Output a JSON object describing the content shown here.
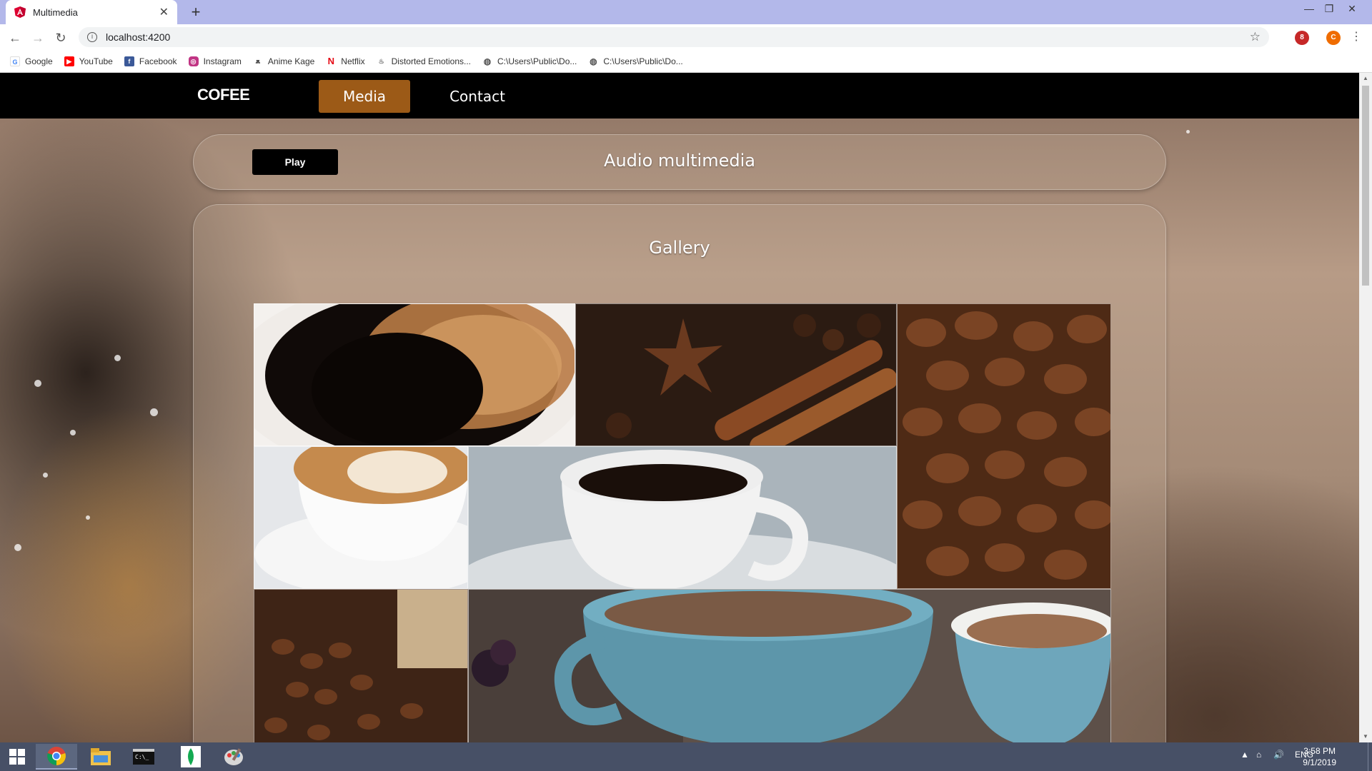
{
  "browser": {
    "tab_title": "Multimedia",
    "new_tab_label": "+",
    "url": "localhost:4200",
    "bookmarks": [
      {
        "label": "Google",
        "icon": "google-icon",
        "color": "#4285f4"
      },
      {
        "label": "YouTube",
        "icon": "youtube-icon",
        "color": "#ff0000"
      },
      {
        "label": "Facebook",
        "icon": "facebook-icon",
        "color": "#3b5998"
      },
      {
        "label": "Instagram",
        "icon": "instagram-icon",
        "color": "#c13584"
      },
      {
        "label": "Anime Kage",
        "icon": "anime-kage-icon",
        "color": "#222222"
      },
      {
        "label": "Netflix",
        "icon": "netflix-icon",
        "color": "#e50914"
      },
      {
        "label": "Distorted Emotions...",
        "icon": "distorted-emotions-icon",
        "color": "#777777"
      },
      {
        "label": "C:\\Users\\Public\\Do...",
        "icon": "globe-icon",
        "color": "#555555"
      },
      {
        "label": "C:\\Users\\Public\\Do...",
        "icon": "globe-icon",
        "color": "#555555"
      }
    ],
    "profile_initial": "C",
    "extension_badge": "8"
  },
  "page": {
    "brand": "COFEE",
    "nav": [
      {
        "label": "Media",
        "active": true
      },
      {
        "label": "Contact",
        "active": false
      }
    ],
    "audio": {
      "play_label": "Play",
      "title": "Audio multimedia"
    },
    "gallery": {
      "title": "Gallery",
      "images": [
        {
          "subject": "espresso-cup-photo"
        },
        {
          "subject": "cinnamon-star-anise-photo"
        },
        {
          "subject": "coffee-beans-photo"
        },
        {
          "subject": "latte-art-photo"
        },
        {
          "subject": "white-cup-coffee-photo"
        },
        {
          "subject": "coffee-beans-jar-photo"
        },
        {
          "subject": "blue-cups-photo"
        }
      ]
    },
    "colors": {
      "accent": "#9c5a17",
      "navbar": "#000000"
    }
  },
  "taskbar": {
    "language": "ENG",
    "time": "3:58 PM",
    "date": "9/1/2019"
  }
}
